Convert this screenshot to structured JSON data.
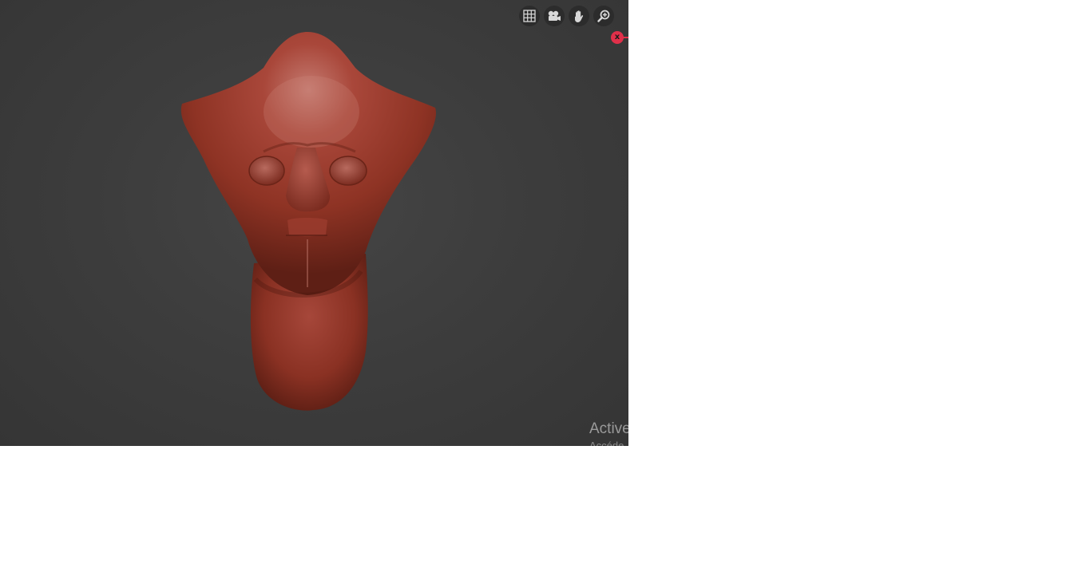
{
  "viewport": {
    "background_color": "#3d3d3d",
    "mesh_color": "#9c3a2a"
  },
  "navigation_tools": [
    {
      "name": "grid-icon"
    },
    {
      "name": "camera-icon"
    },
    {
      "name": "hand-pan-icon"
    },
    {
      "name": "zoom-icon"
    }
  ],
  "close_button": {
    "label": "x",
    "color": "#e0304a"
  },
  "watermark": {
    "title": "Active",
    "subtitle": "Accéde"
  }
}
